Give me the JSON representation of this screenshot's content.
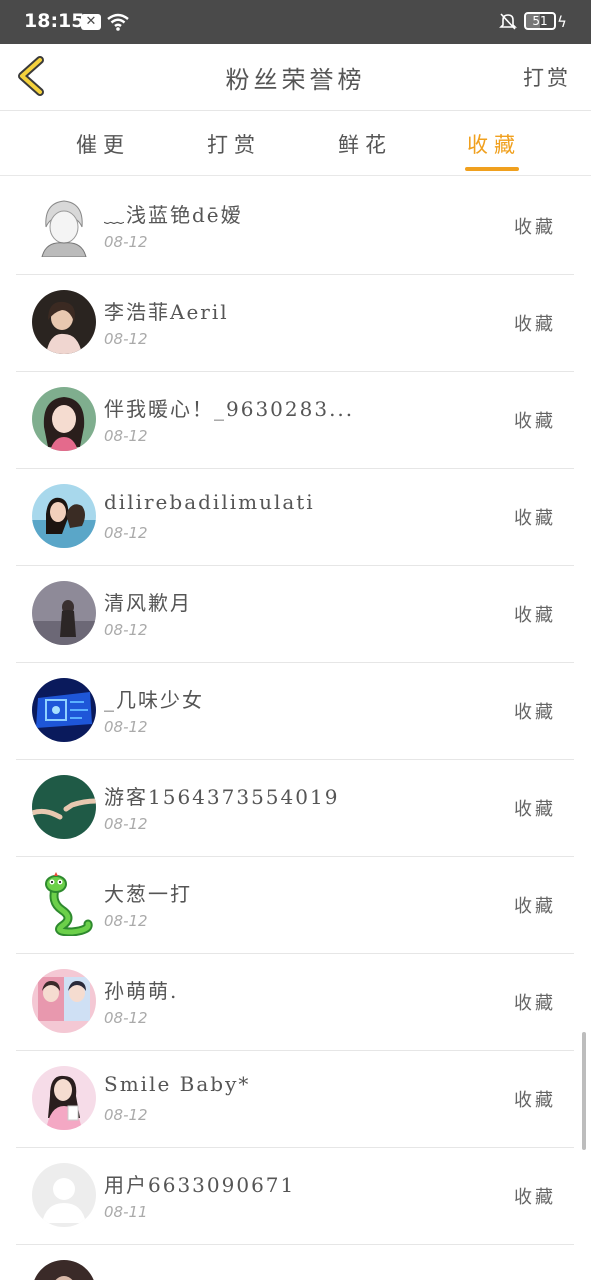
{
  "status_bar": {
    "time": "18:15",
    "notif_badge": "✕",
    "battery": "51",
    "battery_level": 0.51
  },
  "header": {
    "title": "粉丝荣誉榜",
    "action": "打赏"
  },
  "tabs": [
    {
      "label": "催更",
      "active": false
    },
    {
      "label": "打赏",
      "active": false
    },
    {
      "label": "鲜花",
      "active": false
    },
    {
      "label": "收藏",
      "active": true
    }
  ],
  "colors": {
    "accent": "#f0a01e",
    "status_bar": "#4a4a4a"
  },
  "rows": [
    {
      "name": "﹏浅蓝铯dē嫒",
      "date": "08-12",
      "action": "收藏"
    },
    {
      "name": "李浩菲Aeril",
      "date": "08-12",
      "action": "收藏"
    },
    {
      "name": "伴我暖心！_9630283...",
      "date": "08-12",
      "action": "收藏"
    },
    {
      "name": "dilirebadilimulati",
      "date": "08-12",
      "action": "收藏"
    },
    {
      "name": "清风歉月",
      "date": "08-12",
      "action": "收藏"
    },
    {
      "name": "_几味少女",
      "date": "08-12",
      "action": "收藏"
    },
    {
      "name": "游客1564373554019",
      "date": "08-12",
      "action": "收藏"
    },
    {
      "name": "大葱一打",
      "date": "08-12",
      "action": "收藏"
    },
    {
      "name": "孙萌萌.",
      "date": "08-12",
      "action": "收藏"
    },
    {
      "name": "Smile Baby*",
      "date": "08-12",
      "action": "收藏"
    },
    {
      "name": "用户6633090671",
      "date": "08-11",
      "action": "收藏"
    }
  ]
}
